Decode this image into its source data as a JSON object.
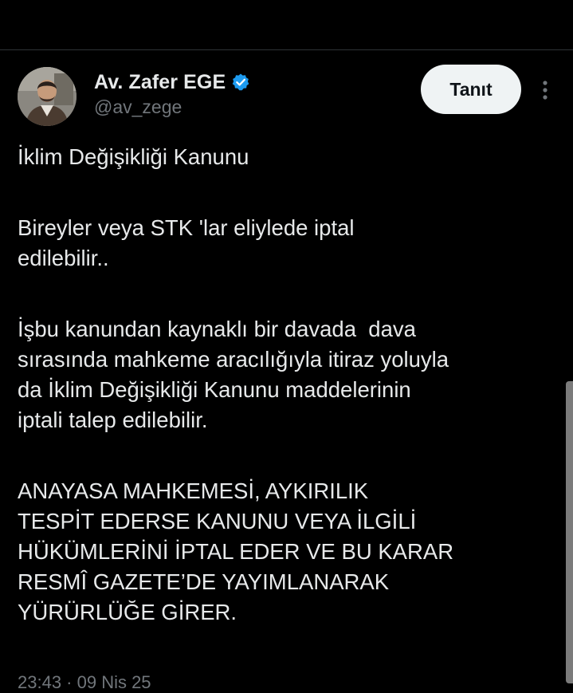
{
  "tweet": {
    "author": {
      "name": "Av. Zafer EGE",
      "handle": "@av_zege",
      "verified": true
    },
    "follow_label": "Tanıt",
    "body": {
      "p1": [
        "İklim Değişikliği Kanunu"
      ],
      "p2": [
        "Bireyler veya STK 'lar eliylede iptal",
        "edilebilir.."
      ],
      "p3": [
        "İşbu kanundan kaynaklı bir davada  dava",
        "sırasında mahkeme aracılığıyla itiraz yoluyla",
        "da İklim Değişikliği Kanunu maddelerinin",
        "iptali talep edilebilir."
      ],
      "p4": [
        "ANAYASA MAHKEMESİ, AYKIRILIK",
        "TESPİT EDERSE KANUNU VEYA İLGİLİ",
        "HÜKÜMLERİNİ İPTAL EDER VE BU KARAR",
        "RESMÎ GAZETE’DE YAYIMLANARAK",
        "YÜRÜRLÜĞE GİRER."
      ]
    },
    "timestamp": "23:43 · 09 Nis 25"
  },
  "colors": {
    "background": "#000000",
    "text": "#e7e9ea",
    "muted": "#71767b",
    "verified": "#1d9bf0",
    "button_bg": "#eff3f4",
    "divider": "#2f3336"
  },
  "icons": {
    "verified": "verified-badge-icon",
    "more": "more-vertical-icon"
  }
}
